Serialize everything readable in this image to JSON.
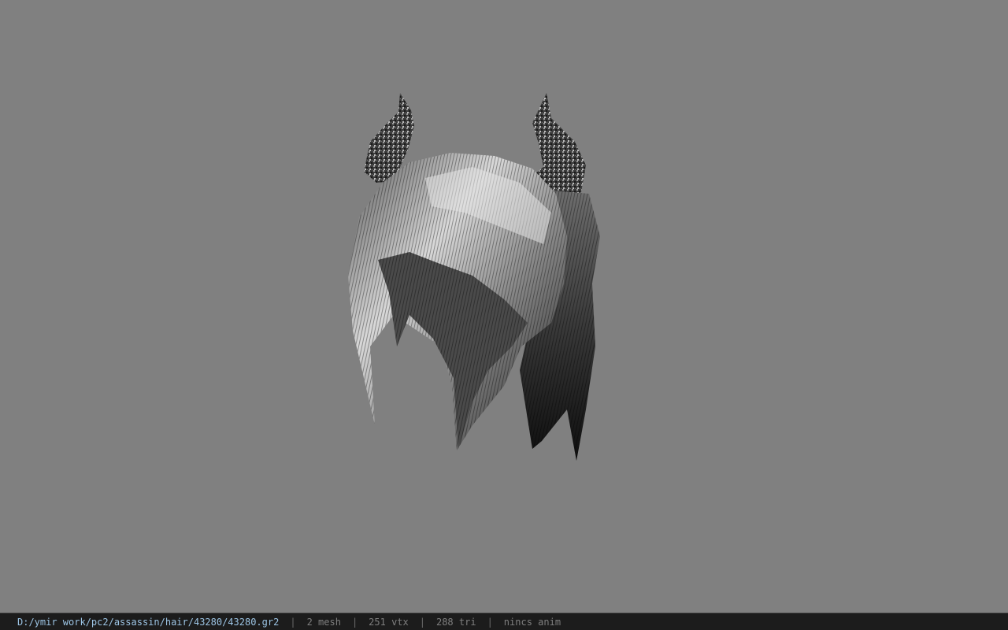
{
  "viewer": {
    "background_color": "#808080",
    "model_icon": "hair-mesh-icon"
  },
  "status": {
    "file_path": "D:/ymir work/pc2/assassin/hair/43280/43280.gr2",
    "separator": "|",
    "mesh_count": "2 mesh",
    "vertex_count": "251 vtx",
    "triangle_count": "288 tri",
    "animation": "nincs anim"
  }
}
